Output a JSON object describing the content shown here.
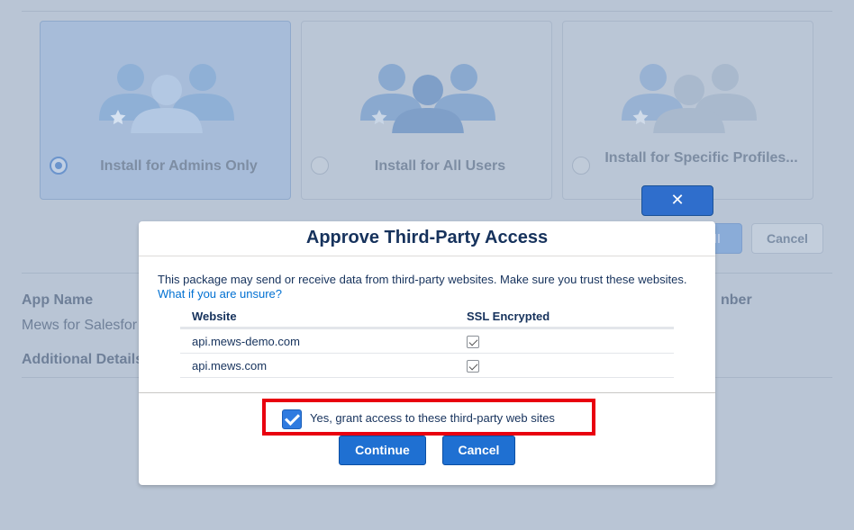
{
  "install_options": [
    {
      "label": "Install for Admins Only",
      "selected": true
    },
    {
      "label": "Install for All Users",
      "selected": false
    },
    {
      "label": "Install for Specific Profiles...",
      "selected": false
    }
  ],
  "background_buttons": {
    "install_label": "ll",
    "cancel_label": "Cancel"
  },
  "app_info": {
    "app_name_label": "App Name",
    "app_name_value": "Mews for Salesfor",
    "additional_details_label": "Additional Details",
    "version_label_fragment": "nber"
  },
  "modal": {
    "close_glyph": "✕",
    "title": "Approve Third-Party Access",
    "message": "This package may send or receive data from third-party websites. Make sure you trust these websites.",
    "help_link": "What if you are unsure?",
    "table": {
      "headers": [
        "Website",
        "SSL Encrypted"
      ],
      "rows": [
        {
          "website": "api.mews-demo.com",
          "ssl": true
        },
        {
          "website": "api.mews.com",
          "ssl": true
        }
      ]
    },
    "grant_label": "Yes, grant access to these third-party web sites",
    "grant_checked": true,
    "continue_label": "Continue",
    "cancel_label": "Cancel"
  },
  "colors": {
    "accent": "#1f70d2",
    "highlight": "#e8000f",
    "title": "#16325c"
  }
}
